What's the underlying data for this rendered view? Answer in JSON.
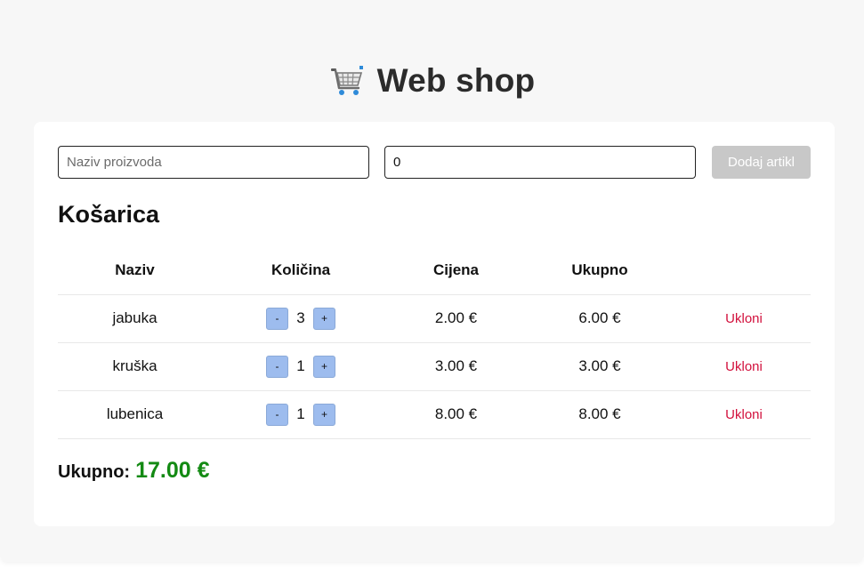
{
  "header": {
    "title": "Web shop",
    "icon": "shopping-cart-icon"
  },
  "form": {
    "name_placeholder": "Naziv proizvoda",
    "name_value": "",
    "qty_value": "0",
    "add_label": "Dodaj artikl"
  },
  "cart": {
    "title": "Košarica",
    "columns": [
      "Naziv",
      "Količina",
      "Cijena",
      "Ukupno",
      ""
    ],
    "rows": [
      {
        "name": "jabuka",
        "quantity": "3",
        "price": "2.00 €",
        "total": "6.00 €",
        "remove": "Ukloni"
      },
      {
        "name": "kruška",
        "quantity": "1",
        "price": "3.00 €",
        "total": "3.00 €",
        "remove": "Ukloni"
      },
      {
        "name": "lubenica",
        "quantity": "1",
        "price": "8.00 €",
        "total": "8.00 €",
        "remove": "Ukloni"
      }
    ],
    "decrement_label": "-",
    "increment_label": "+"
  },
  "summary": {
    "label": "Ukupno:",
    "value": "17.00 €"
  },
  "colors": {
    "accent_total": "#138a13",
    "remove": "#d2103c",
    "stepper": "#9dbcee",
    "disabled_button": "#c8c8c8"
  }
}
